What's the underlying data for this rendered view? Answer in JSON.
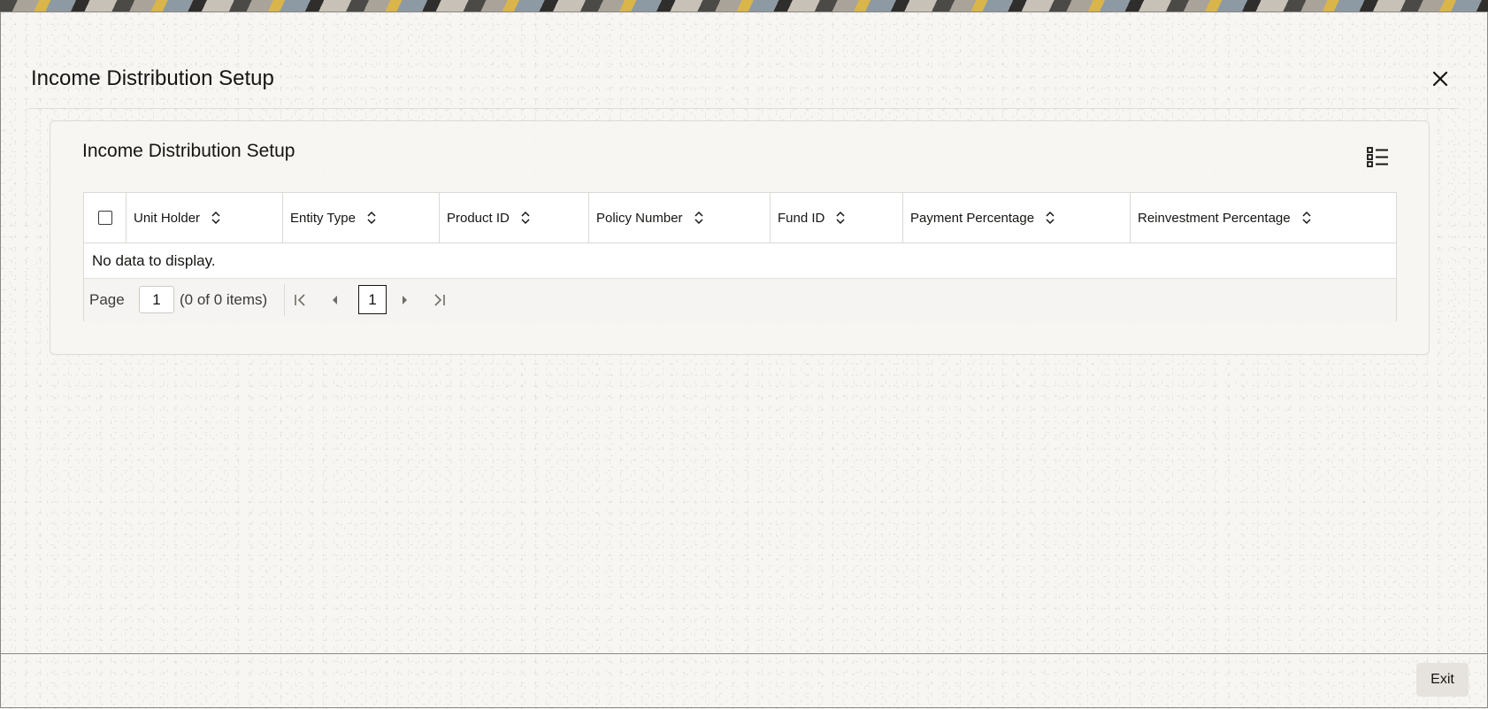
{
  "dialog": {
    "title": "Income Distribution Setup",
    "close_icon": "close-icon"
  },
  "panel": {
    "title": "Income Distribution Setup",
    "columns_icon": "column-list-icon"
  },
  "grid": {
    "columns": [
      {
        "label": "Unit Holder"
      },
      {
        "label": "Entity Type"
      },
      {
        "label": "Product ID"
      },
      {
        "label": "Policy Number"
      },
      {
        "label": "Fund ID"
      },
      {
        "label": "Payment Percentage"
      },
      {
        "label": "Reinvestment Percentage"
      }
    ],
    "rows": [],
    "empty_message": "No data to display."
  },
  "pager": {
    "page_label": "Page",
    "page_value": "1",
    "items_text": "(0 of 0 items)",
    "current_page": "1"
  },
  "footer": {
    "exit_label": "Exit"
  }
}
